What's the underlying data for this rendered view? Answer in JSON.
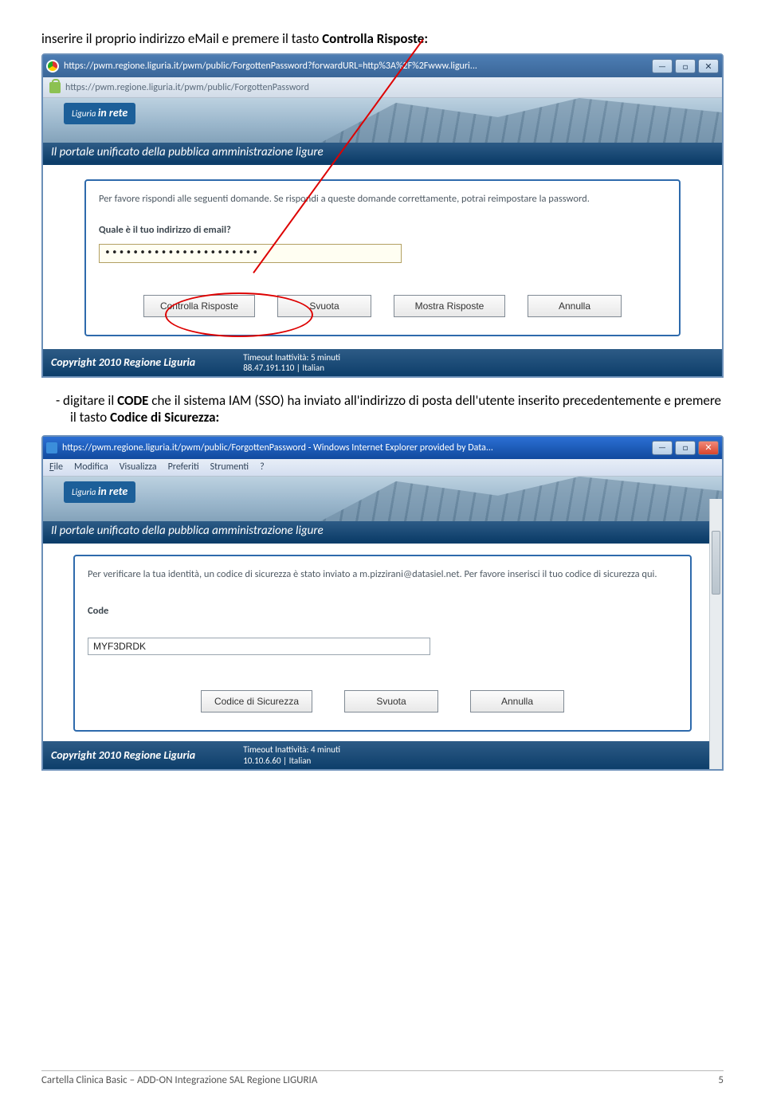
{
  "instruction1_prefix": "inserire il proprio indirizzo eMail e premere il tasto ",
  "instruction1_bold": "Controlla Risposte:",
  "instruction2_prefix": "-   digitare il ",
  "instruction2_bold1": "CODE",
  "instruction2_mid": " che il sistema IAM (SSO) ha inviato all'indirizzo di posta dell'utente inserito precedentemente e premere il tasto ",
  "instruction2_bold2": "Codice di Sicurezza:",
  "window1": {
    "title_url": "https://pwm.regione.liguria.it/pwm/public/ForgottenPassword?forwardURL=http%3A%2F%2Fwww.liguri...",
    "address_url": "https://pwm.regione.liguria.it/pwm/public/ForgottenPassword",
    "logo_small": "Liguria",
    "logo_big": "in rete",
    "banner_text": "Il portale unificato della pubblica amministrazione ligure",
    "panel_intro": "Per favore rispondi alle seguenti domande. Se rispondi a queste domande correttamente, potrai reimpostare la password.",
    "question": "Quale è il tuo indirizzo di email?",
    "input_value": "••••••••••••••••••••••",
    "buttons": {
      "check": "Controlla Risposte",
      "clear": "Svuota",
      "show": "Mostra Risposte",
      "cancel": "Annulla"
    },
    "footer_copyright": "Copyright 2010 Regione Liguria",
    "footer_timeout": "Timeout Inattività: 5 minuti",
    "footer_ip": "88.47.191.110 | Italian"
  },
  "window2": {
    "title": "https://pwm.regione.liguria.it/pwm/public/ForgottenPassword - Windows Internet Explorer provided by Data...",
    "menu": {
      "file": "File",
      "edit": "Modifica",
      "view": "Visualizza",
      "fav": "Preferiti",
      "tools": "Strumenti",
      "help": "?"
    },
    "logo_small": "Liguria",
    "logo_big": "in rete",
    "banner_text": "Il portale unificato della pubblica amministrazione ligure",
    "panel_intro": "Per verificare la tua identità, un codice di sicurezza è stato inviato a m.pizzirani@datasiel.net. Per favore inserisci il tuo codice di sicurezza qui.",
    "code_label": "Code",
    "code_value": "MYF3DRDK",
    "buttons": {
      "submit": "Codice di Sicurezza",
      "clear": "Svuota",
      "cancel": "Annulla"
    },
    "footer_copyright": "Copyright 2010 Regione Liguria",
    "footer_timeout": "Timeout Inattività: 4 minuti",
    "footer_ip": "10.10.6.60 | Italian"
  },
  "doc_footer_left": "Cartella Clinica Basic – ADD-ON Integrazione SAL Regione LIGURIA",
  "doc_footer_right": "5"
}
